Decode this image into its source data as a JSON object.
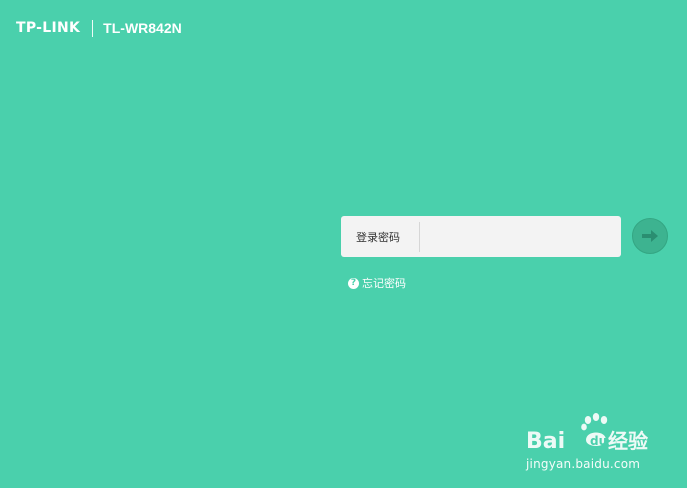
{
  "header": {
    "brand": "TP-LINK",
    "model": "TL-WR842N"
  },
  "login": {
    "password_label": "登录密码",
    "password_value": "",
    "submit_icon": "arrow-right-icon",
    "forgot_label": "忘记密码",
    "forgot_icon": "question-circle-icon"
  },
  "watermark": {
    "logo_text": "Bai du 经验",
    "url": "jingyan.baidu.com"
  },
  "colors": {
    "background": "#4ad0ac",
    "input_background": "#f3f3f3",
    "button": "#3db390",
    "arrow": "#2a8e71"
  }
}
